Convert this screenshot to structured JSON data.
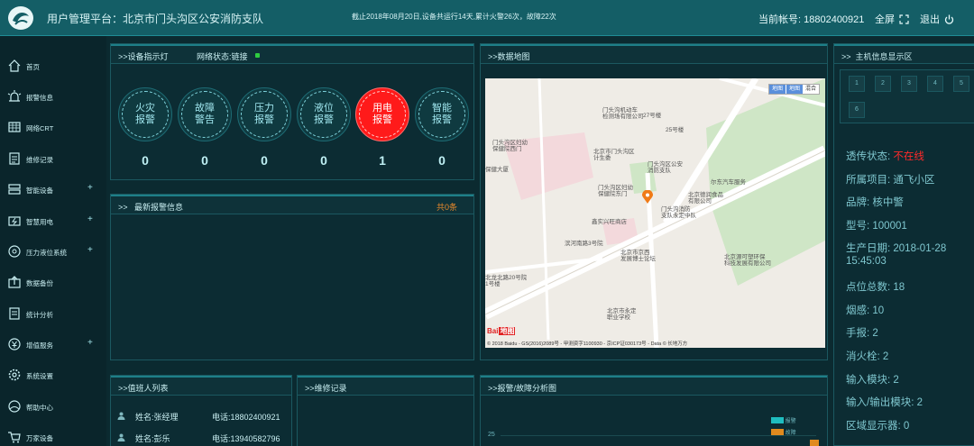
{
  "header": {
    "title": "用户管理平台：北京市门头沟区公安消防支队",
    "notice": "截止2018年08月20日,设备共运行14天,累计火警26次，故障22次",
    "account": "当前帐号: 18802400921",
    "fullscreen_label": "全屏",
    "logout_label": "退出"
  },
  "sidebar": {
    "items": [
      {
        "label": "首页",
        "icon": "home-icon"
      },
      {
        "label": "报警信息",
        "icon": "alarm-icon"
      },
      {
        "label": "网络CRT",
        "icon": "crt-icon"
      },
      {
        "label": "维修记录",
        "icon": "repair-icon"
      },
      {
        "label": "智能设备",
        "icon": "device-icon",
        "plus": "+"
      },
      {
        "label": "智慧用电",
        "icon": "power-icon",
        "plus": "+"
      },
      {
        "label": "压力液位系统",
        "icon": "pressure-icon",
        "plus": "+"
      },
      {
        "label": "数据备份",
        "icon": "backup-icon"
      },
      {
        "label": "统计分析",
        "icon": "stats-icon"
      },
      {
        "label": "增值服务",
        "icon": "service-icon",
        "plus": "+"
      },
      {
        "label": "系统设置",
        "icon": "settings-icon"
      },
      {
        "label": "帮助中心",
        "icon": "help-icon"
      },
      {
        "label": "万家设备",
        "icon": "cart-icon"
      }
    ]
  },
  "indicator": {
    "title": "设备指示灯",
    "network_label": "网络状态:链接",
    "network_color": "#2ecc40",
    "lights": [
      {
        "line1": "火灾",
        "line2": "报警",
        "count": "0",
        "active": false
      },
      {
        "line1": "故障",
        "line2": "警告",
        "count": "0",
        "active": false
      },
      {
        "line1": "压力",
        "line2": "报警",
        "count": "0",
        "active": false
      },
      {
        "line1": "液位",
        "line2": "报警",
        "count": "0",
        "active": false
      },
      {
        "line1": "用电",
        "line2": "报警",
        "count": "1",
        "active": true
      },
      {
        "line1": "智能",
        "line2": "报警",
        "count": "0",
        "active": false
      }
    ]
  },
  "latest_alarm": {
    "title": "最新报警信息",
    "total": "共0条"
  },
  "map_panel": {
    "title": "数据地图",
    "map_types": [
      "地图",
      "地图",
      "混合"
    ],
    "copyright": "© 2018 Baidu - GS(2016)2089号 - 甲测资字1100930 - 京ICP证030173号 - Data © 长地万方",
    "baidu_logo": "Bai",
    "baidu_logo2": "地图",
    "labels": [
      "门头沟机动车\n检测场有限公司",
      "北京市门头沟区\n计生委",
      "门头沟区妇幼\n保健院西门",
      "门头沟区公安\n消防支队",
      "尔东汽车服务",
      "门头沟区妇幼\n保健院东门",
      "北京德润食品\n有限公司",
      "门头沟消防\n支队永定中队",
      "鑫实兴旺商店",
      "滨河南路3号院",
      "北京市京西\n发展博士论坛",
      "北京源可塑环保\n科技发展有限公司",
      "北龙北路20号院\n1号楼",
      "北京市永定\n职业学校",
      "保健大厦",
      "27号楼",
      "25号楼"
    ]
  },
  "host_panel": {
    "title": "主机信息显示区",
    "cells": [
      "1",
      "2",
      "3",
      "4",
      "5",
      "6"
    ],
    "status_label": "透传状态: ",
    "status_value": "不在线",
    "status_color": "#ff2a2a",
    "lines": [
      "所属项目: 通飞小区",
      "品牌: 核中警",
      "型号: 100001",
      "生产日期: 2018-01-28",
      "15:45:03",
      "点位总数: 18",
      "烟感: 10",
      "手报: 2",
      "消火栓: 2",
      "输入模块: 2",
      "输入/输出模块: 2",
      "区域显示器: 0"
    ]
  },
  "duty_panel": {
    "title": "值班人列表",
    "rows": [
      {
        "name": "姓名:张经理",
        "tel": "电话:18802400921"
      },
      {
        "name": "姓名:彭乐",
        "tel": "电话:13940582796"
      }
    ]
  },
  "repair_panel": {
    "title": "维修记录"
  },
  "analysis_panel": {
    "title": "报警/故障分析图",
    "chart_data": {
      "type": "bar",
      "ytick_visible": "25",
      "legend": [
        "报警",
        "故障"
      ],
      "legend_colors": [
        "#1fbdbf",
        "#e08a1e"
      ]
    }
  }
}
